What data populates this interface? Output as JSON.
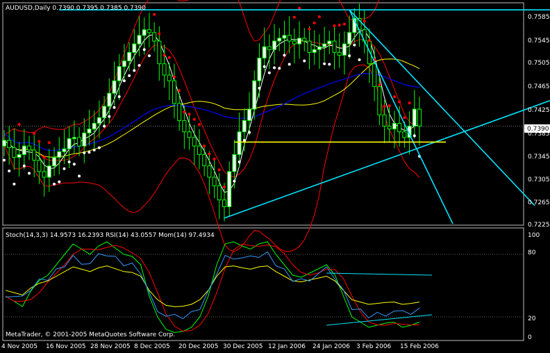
{
  "main_panel": {
    "header": "AUDUSD,Daily  0.7390 0.7395 0.7385 0.7390",
    "price_axis_labels": [
      "0.7585",
      "0.7545",
      "0.7505",
      "0.7465",
      "0.7425",
      "0.7385",
      "0.7345",
      "0.7305",
      "0.7265",
      "0.7225"
    ],
    "current_price_label": "0.7390"
  },
  "sub_panel": {
    "header": "Stoch(14,3,3) 14.9573 16.2393  RSI(14) 43.0557  Mom(14) 97.4934",
    "axis_labels": [
      "100",
      "80",
      "20",
      "0"
    ],
    "footer": "MetaTrader, © 2001-2005 MetaQuotes Software Corp."
  },
  "date_axis_labels": [
    "4 Nov 2005",
    "16 Nov 2005",
    "28 Nov 2005",
    "8 Dec 2005",
    "20 Dec 2005",
    "30 Dec 2005",
    "12 Jan 2006",
    "24 Jan 2006",
    "3 Feb 2006",
    "15 Feb 2006"
  ],
  "colors": {
    "candle_up": "#ffffff",
    "candle_down": "#000000",
    "candle_body_up_fill": "#ffffff",
    "wick": "#00ff00",
    "grid": "#c0c0c0",
    "trendline": "#00e5ff",
    "horizontal_support": "#ffff00",
    "bollinger": "#ff0000",
    "ma_blue": "#0000ff",
    "ma_yellow": "#ffff00",
    "ma_white": "#ffffff",
    "sar_red": "#ff0000",
    "sar_white": "#ffffff",
    "stoch_main": "#00ff00",
    "stoch_signal": "#ff0000",
    "rsi": "#ffff00",
    "momentum": "#3399ff"
  },
  "chart_data": {
    "type": "candlestick",
    "symbol": "AUDUSD",
    "timeframe": "Daily",
    "last_ohlc": {
      "open": 0.739,
      "high": 0.7395,
      "low": 0.7385,
      "close": 0.739
    },
    "y_range": [
      0.7218,
      0.7605
    ],
    "close_series": [
      0.7365,
      0.7352,
      0.7335,
      0.734,
      0.7355,
      0.7348,
      0.733,
      0.731,
      0.73,
      0.732,
      0.7335,
      0.7345,
      0.735,
      0.7368,
      0.737,
      0.7355,
      0.7378,
      0.7385,
      0.7395,
      0.7405,
      0.7425,
      0.7448,
      0.747,
      0.7495,
      0.7505,
      0.752,
      0.7535,
      0.755,
      0.756,
      0.7555,
      0.754,
      0.75,
      0.748,
      0.747,
      0.743,
      0.74,
      0.738,
      0.737,
      0.7355,
      0.734,
      0.732,
      0.73,
      0.7285,
      0.726,
      0.7248,
      0.731,
      0.734,
      0.738,
      0.74,
      0.742,
      0.747,
      0.751,
      0.753,
      0.7525,
      0.754,
      0.7545,
      0.755,
      0.754,
      0.7535,
      0.7545,
      0.754,
      0.752,
      0.7525,
      0.753,
      0.7535,
      0.754,
      0.752,
      0.7515,
      0.7535,
      0.7555,
      0.758,
      0.756,
      0.754,
      0.75,
      0.746,
      0.741,
      0.739,
      0.7385,
      0.7395,
      0.738,
      0.737,
      0.739,
      0.742,
      0.739
    ],
    "stoch_main": [
      40,
      35,
      30,
      45,
      55,
      60,
      70,
      80,
      90,
      85,
      80,
      88,
      92,
      86,
      80,
      78,
      70,
      40,
      20,
      8,
      5,
      6,
      10,
      20,
      40,
      70,
      90,
      92,
      88,
      85,
      90,
      92,
      80,
      70,
      60,
      58,
      62,
      66,
      70,
      60,
      40,
      20,
      15,
      10,
      12,
      14,
      15,
      10,
      12,
      15
    ],
    "indicators": [
      "Stoch(14,3,3) 14.9573 16.2393",
      "RSI(14) 43.0557",
      "Mom(14) 97.4934"
    ]
  }
}
